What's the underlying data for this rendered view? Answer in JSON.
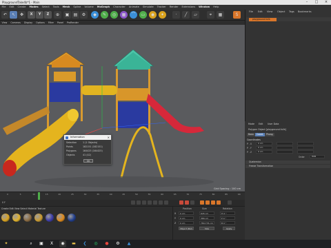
{
  "window": {
    "title": "PlaygroundTake4b*1 - Main"
  },
  "menubar": {
    "items": [
      "File",
      "Edit",
      "Create",
      "Modes",
      "Select",
      "Tools",
      "Mesh",
      "Spline",
      "Volume",
      "MoGraph",
      "Character",
      "Animate",
      "Simulate",
      "Tracker",
      "Render",
      "Extensions",
      "Window",
      "Help"
    ]
  },
  "toolbar": {
    "xyz": [
      "X",
      "Y",
      "Z"
    ]
  },
  "viewport_tabs": [
    "View",
    "Cameras",
    "Display",
    "Options",
    "Filter",
    "Panel",
    "ProRender"
  ],
  "viewport": {
    "grid_spacing": "Grid Spacing : 100 cm"
  },
  "info_dialog": {
    "title": "Information",
    "rows": [
      {
        "label": "Selection",
        "value": "1 (1 Objects)"
      },
      {
        "label": "Points",
        "value": "182151 (182151)"
      },
      {
        "label": "Polygons",
        "value": "164425 (164425)"
      },
      {
        "label": "Objects",
        "value": "41 (42)"
      }
    ],
    "ok_label": "OK"
  },
  "timeline": {
    "ticks": [
      "0",
      "5",
      "10",
      "15",
      "20",
      "25",
      "30",
      "35",
      "40",
      "45",
      "50",
      "55",
      "60",
      "65",
      "70",
      "75",
      "80",
      "85",
      "90"
    ],
    "frame": "0 F"
  },
  "materials": {
    "menu": [
      "Create",
      "Edit",
      "View",
      "Select",
      "Material",
      "Texture"
    ],
    "balls": [
      {
        "name": "Mat.1",
        "color": "#d9a21e"
      },
      {
        "name": "Mat.2",
        "color": "#e0b12a"
      },
      {
        "name": "Mat.3",
        "color": "#8a6a40"
      },
      {
        "name": "Mat.4",
        "color": "#c99a30"
      },
      {
        "name": "Mat.5",
        "color": "#3a3aa8"
      },
      {
        "name": "Mat.6",
        "color": "#e08a1a"
      },
      {
        "name": "Mat.7",
        "color": "#1e3c8c"
      }
    ]
  },
  "coordinates": {
    "headers": [
      "Position",
      "Size",
      "Rotation"
    ],
    "rows": [
      {
        "axis": "X",
        "pos": "0 cm",
        "size": "645 cm",
        "rot": "H 0 °"
      },
      {
        "axis": "Y",
        "pos": "0 cm",
        "size": "366 cm",
        "rot": "P 0 °"
      },
      {
        "axis": "Z",
        "pos": "0 cm",
        "size": "789.776 cm",
        "rot": "B 0 °"
      }
    ],
    "mode": "Object (Rel)",
    "size_mode": "Size",
    "apply": "Apply"
  },
  "objects_panel": {
    "menu": [
      "File",
      "Edit",
      "View",
      "Object",
      "Tags",
      "Bookmarks"
    ],
    "object_name": "playground.fullk"
  },
  "attributes": {
    "menu": [
      "Mode",
      "Edit",
      "User Data"
    ],
    "object_line": "Polygon Object [playground.fullk]",
    "tabs": [
      "Basic",
      "Coord.",
      "Phong"
    ],
    "section": "Coordinates",
    "fields": [
      {
        "label": "P . X",
        "value": "0 cm"
      },
      {
        "label": "P . Y",
        "value": "0 cm"
      },
      {
        "label": "P . Z",
        "value": "0 cm"
      }
    ],
    "order_label": "Order",
    "order_value": "HPB",
    "sections": [
      "Quaternion",
      "Freeze Transformation"
    ]
  },
  "taskbar": {
    "icons": [
      "start-icon",
      "search-icon",
      "widgets-icon",
      "x-icon",
      "cinema4d-icon",
      "explorer-icon",
      "vscode-icon",
      "whatsapp-icon",
      "chrome-icon",
      "settings-icon",
      "photos-icon"
    ]
  }
}
